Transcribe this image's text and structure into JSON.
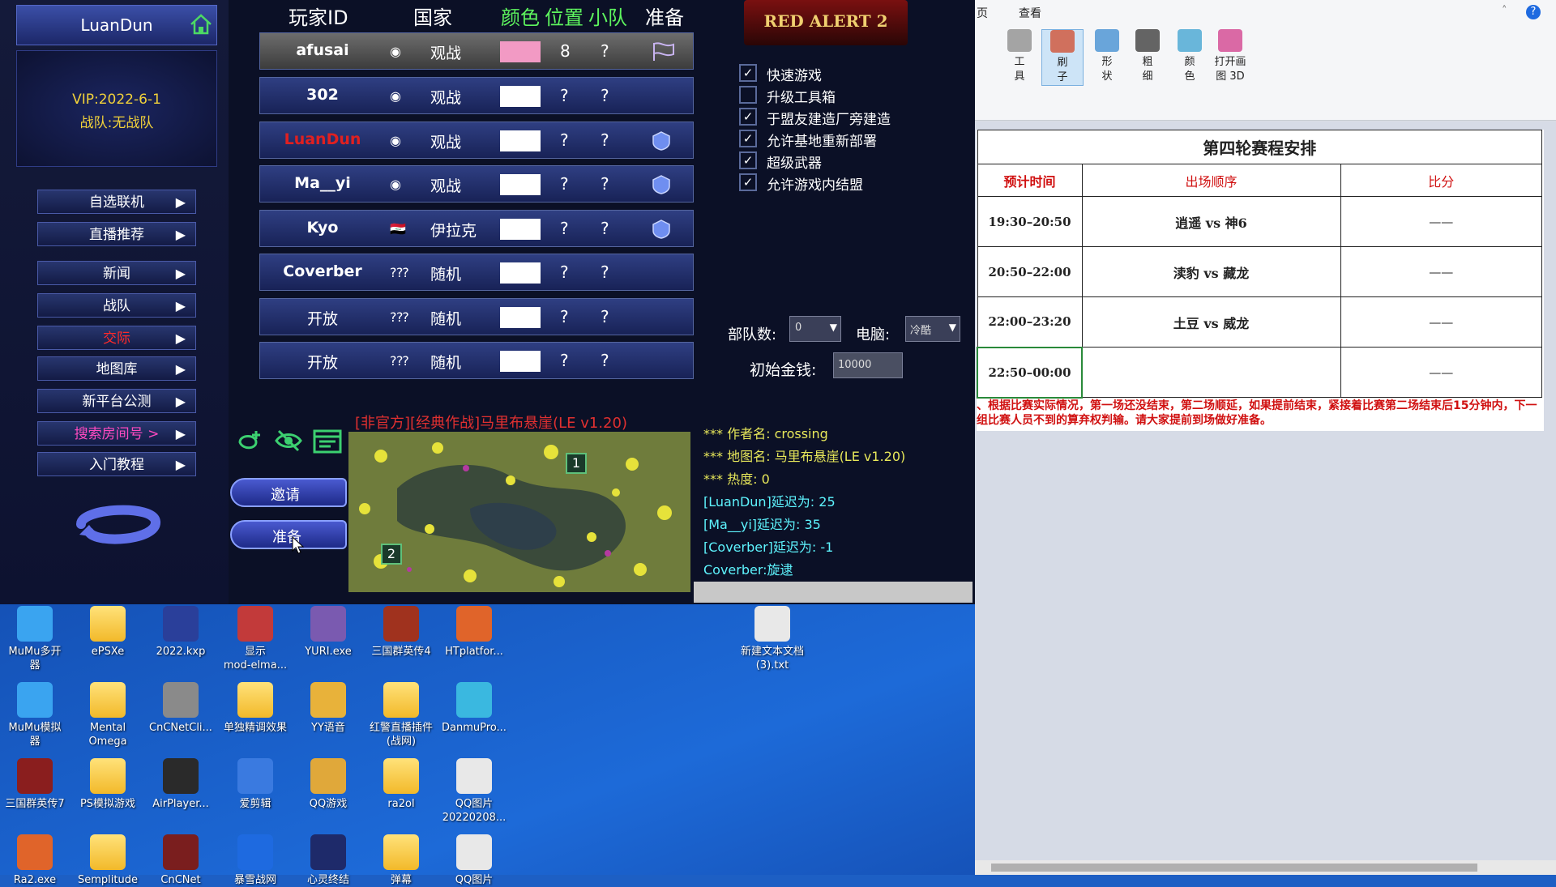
{
  "game": {
    "user": {
      "name": "LuanDun",
      "vip": "VIP:2022-6-1",
      "team": "战队:无战队"
    },
    "nav": [
      "自选联机",
      "直播推荐",
      "新闻",
      "战队",
      "交际",
      "地图库",
      "新平台公测",
      "搜索房间号 >",
      "入门教程"
    ],
    "headers": {
      "player": "玩家ID",
      "country": "国家",
      "color": "颜色",
      "position": "位置",
      "team": "小队",
      "ready": "准备"
    },
    "players": [
      {
        "name": "afusai",
        "flag": "◉",
        "country": "观战",
        "color": "#f29ac4",
        "pos": "8",
        "team": "?"
      },
      {
        "name": "302",
        "flag": "◉",
        "country": "观战",
        "color": "#ffffff",
        "pos": "?",
        "team": "?"
      },
      {
        "name": "LuanDun",
        "flag": "◉",
        "country": "观战",
        "color": "#ffffff",
        "pos": "?",
        "team": "?"
      },
      {
        "name": "Ma__yi",
        "flag": "◉",
        "country": "观战",
        "color": "#ffffff",
        "pos": "?",
        "team": "?"
      },
      {
        "name": "Kyo",
        "flag": "🇮🇶",
        "country": "伊拉克",
        "color": "#ffffff",
        "pos": "?",
        "team": "?"
      },
      {
        "name": "Coverber",
        "flag": "?⁇",
        "country": "随机",
        "color": "#ffffff",
        "pos": "?",
        "team": "?"
      },
      {
        "name": "开放",
        "flag": "?⁇",
        "country": "随机",
        "color": "#ffffff",
        "pos": "?",
        "team": "?"
      },
      {
        "name": "开放",
        "flag": "?⁇",
        "country": "随机",
        "color": "#ffffff",
        "pos": "?",
        "team": "?"
      }
    ],
    "options": [
      {
        "label": "快速游戏",
        "checked": true
      },
      {
        "label": "升级工具箱",
        "checked": false
      },
      {
        "label": "于盟友建造厂旁建造",
        "checked": true
      },
      {
        "label": "允许基地重新部署",
        "checked": true
      },
      {
        "label": "超级武器",
        "checked": true
      },
      {
        "label": "允许游戏内结盟",
        "checked": true
      }
    ],
    "units_label": "部队数:",
    "units_value": "0",
    "ai_label": "电脑:",
    "ai_value": "冷酷",
    "money_label": "初始金钱:",
    "money_value": "10000",
    "map_title": "[非官方][经典作战]马里布悬崖(LE v1.20)",
    "invite_label": "邀请",
    "ready_label": "准备",
    "map_markers": [
      "1",
      "2"
    ],
    "info_lines": [
      "*** 作者名: crossing",
      "*** 地图名: 马里布悬崖(LE v1.20)",
      "*** 热度: 0",
      "[LuanDun]延迟为: 25",
      "[Ma__yi]延迟为: 35",
      "[Coverber]延迟为: -1",
      "Coverber:旋逮"
    ],
    "logo_text": "RED ALERT 2"
  },
  "paint": {
    "tabs": [
      "页",
      "查看"
    ],
    "tools": [
      {
        "label": "工\n具"
      },
      {
        "label": "刷\n子"
      },
      {
        "label": "形\n状"
      },
      {
        "label": "粗\n细"
      },
      {
        "label": "颜\n色"
      },
      {
        "label": "打开画\n图 3D"
      }
    ],
    "table_title": "第四轮赛程安排",
    "col_headers": [
      "预计时间",
      "出场顺序",
      "比分"
    ],
    "rows": [
      {
        "time": "19:30–20:50",
        "order": "逍遥 vs 神6",
        "score": "——"
      },
      {
        "time": "20:50–22:00",
        "order": "渎豹 vs 藏龙",
        "score": "——"
      },
      {
        "time": "22:00–23:20",
        "order": "土豆 vs 威龙",
        "score": "——"
      },
      {
        "time": "22:50–00:00",
        "order": "",
        "score": "——"
      }
    ],
    "note": "、根据比赛实际情况，第一场还没结束，第二场顺延，如果提前结束，紧接着比赛第二场结束后15分钟内，下一组比赛人员不到的算弃权判输。请大家提前到场做好准备。"
  },
  "desktop": {
    "icons": [
      {
        "label": "MuMu多开\n器",
        "color": "#3aa4f0"
      },
      {
        "label": "ePSXe",
        "color": "folder"
      },
      {
        "label": "2022.kxp",
        "color": "#2a3f9a"
      },
      {
        "label": "显示\nmod-elma...",
        "color": "#c23a3a"
      },
      {
        "label": "YURI.exe",
        "color": "#7a5ab0"
      },
      {
        "label": "三国群英传4",
        "color": "#a0321e"
      },
      {
        "label": "HTplatfor...",
        "color": "#e0642a"
      },
      {
        "label": "新建文本文档\n(3).txt",
        "color": "#e8e8e8"
      },
      {
        "label": "MuMu模拟\n器",
        "color": "#3aa4f0"
      },
      {
        "label": "Mental\nOmega",
        "color": "folder"
      },
      {
        "label": "CnCNetCli...",
        "color": "#8a8a8a"
      },
      {
        "label": "单独精调效果",
        "color": "folder"
      },
      {
        "label": "YY语音",
        "color": "#e8b23a"
      },
      {
        "label": "红警直播插件\n(战网)",
        "color": "folder"
      },
      {
        "label": "DanmuPro...",
        "color": "#3ab8e0"
      },
      {
        "label": "三国群英传7",
        "color": "#8a1e1e"
      },
      {
        "label": "PS模拟游戏",
        "color": "folder"
      },
      {
        "label": "AirPlayer...",
        "color": "#2a2a2a"
      },
      {
        "label": "爱剪辑",
        "color": "#3a7ae0"
      },
      {
        "label": "QQ游戏",
        "color": "#e0a83a"
      },
      {
        "label": "ra2ol",
        "color": "folder"
      },
      {
        "label": "QQ图片\n20220208...",
        "color": "#e8e8e8"
      },
      {
        "label": "Ra2.exe",
        "color": "#e0642a"
      },
      {
        "label": "Semplitude",
        "color": "folder"
      },
      {
        "label": "CnCNet",
        "color": "#7a1e1e"
      },
      {
        "label": "暴雪战网",
        "color": "#1e6ae0"
      },
      {
        "label": "心灵终结",
        "color": "#1e2a6a"
      },
      {
        "label": "弹幕",
        "color": "folder"
      },
      {
        "label": "QQ图片",
        "color": "#e8e8e8"
      }
    ]
  }
}
